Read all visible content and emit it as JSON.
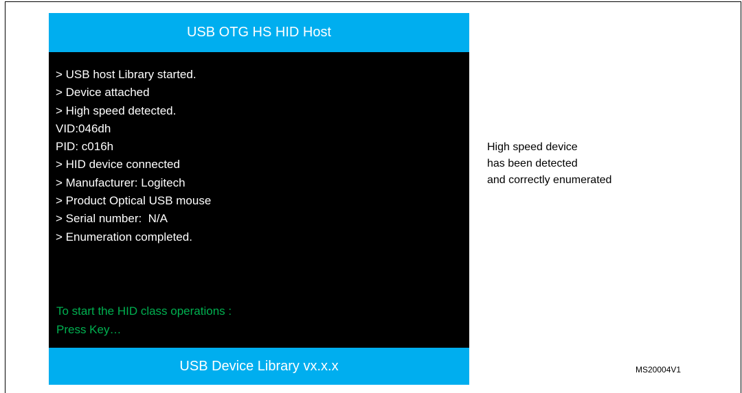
{
  "colors": {
    "banner": "#00aeef",
    "screen_background": "#000000",
    "log_text": "#ffffff",
    "prompt_text": "#00b050"
  },
  "screen": {
    "header": "USB OTG HS HID Host",
    "log_lines": [
      "> USB host Library started.",
      "> Device attached",
      "> High speed detected.",
      "VID:046dh",
      "PID: c016h",
      "> HID device connected",
      "> Manufacturer: Logitech",
      "> Product Optical USB mouse",
      "> Serial number:  N/A",
      "> Enumeration completed."
    ],
    "prompt_lines": [
      "To start the HID class operations :",
      "Press Key…"
    ],
    "footer": "USB Device Library vx.x.x"
  },
  "annotation": {
    "lines": [
      "High speed device",
      "has been detected",
      "and correctly enumerated"
    ]
  },
  "figure_id": "MS20004V1"
}
